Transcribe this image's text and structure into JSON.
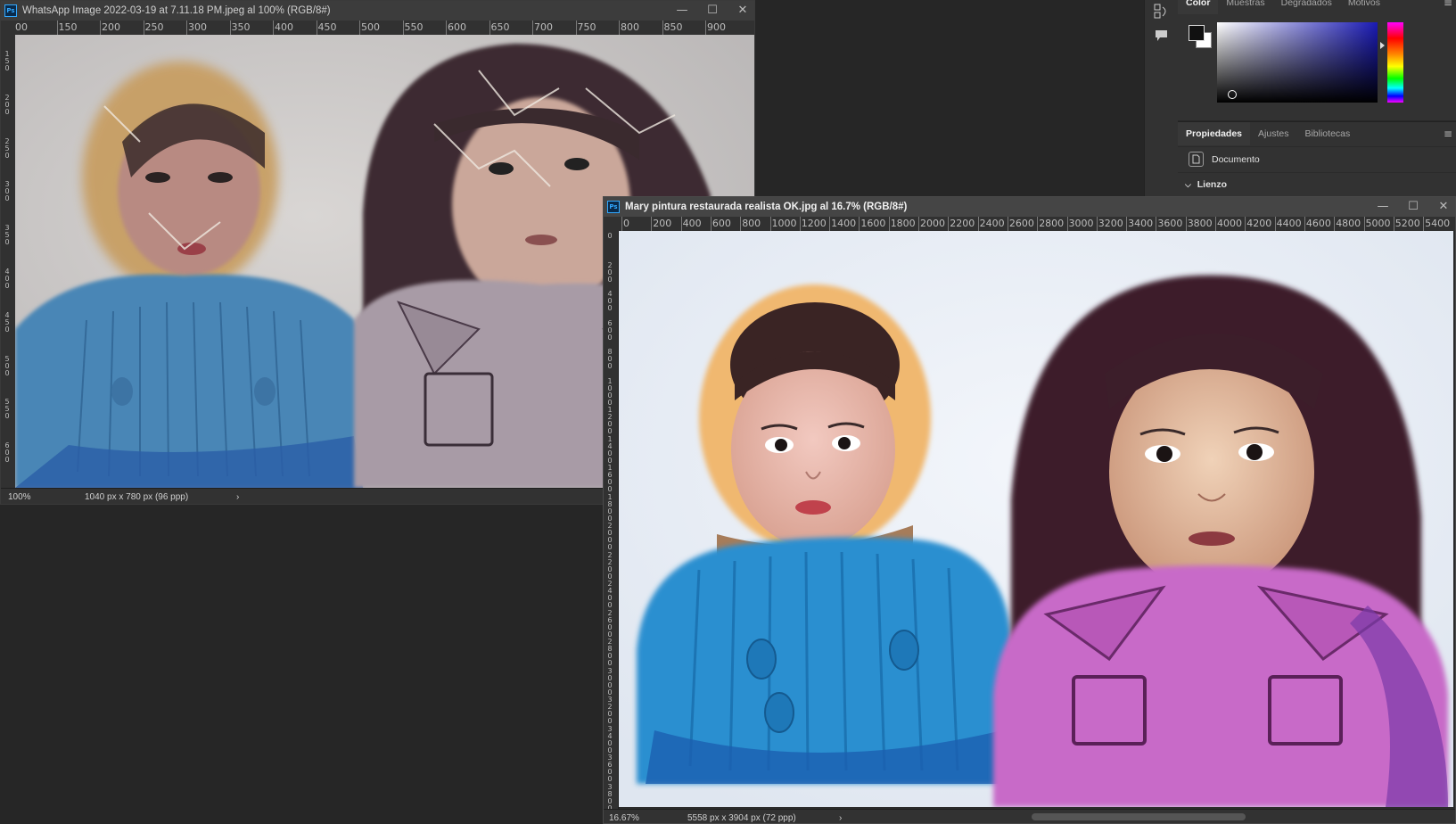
{
  "doc1": {
    "title": "WhatsApp Image 2022-03-19 at 7.11.18 PM.jpeg al 100% (RGB/8#)",
    "ruler_h": [
      "00",
      "150",
      "200",
      "250",
      "300",
      "350",
      "400",
      "450",
      "500",
      "550",
      "600",
      "650",
      "700",
      "750",
      "800",
      "850",
      "900"
    ],
    "ruler_v": [
      "1\n5\n0",
      "2\n0\n0",
      "2\n5\n0",
      "3\n0\n0",
      "3\n5\n0",
      "4\n0\n0",
      "4\n5\n0",
      "5\n0\n0",
      "5\n5\n0",
      "6\n0\n0"
    ],
    "zoom": "100%",
    "size_info": "1040 px x 780 px (96 ppp)",
    "status_arrow": "›"
  },
  "doc2": {
    "title": "Mary pintura restaurada realista OK.jpg al 16.7% (RGB/8#)",
    "ruler_h": [
      "0",
      "200",
      "400",
      "600",
      "800",
      "1000",
      "1200",
      "1400",
      "1600",
      "1800",
      "2000",
      "2200",
      "2400",
      "2600",
      "2800",
      "3000",
      "3200",
      "3400",
      "3600",
      "3800",
      "4000",
      "4200",
      "4400",
      "4600",
      "4800",
      "5000",
      "5200",
      "5400"
    ],
    "ruler_v": [
      "0",
      "2\n0\n0",
      "4\n0\n0",
      "6\n0\n0",
      "8\n0\n0",
      "1\n0\n0\n0",
      "1\n2\n0\n0",
      "1\n4\n0\n0",
      "1\n6\n0\n0",
      "1\n8\n0\n0",
      "2\n0\n0\n0",
      "2\n2\n0\n0",
      "2\n4\n0\n0",
      "2\n6\n0\n0",
      "2\n8\n0\n0",
      "3\n0\n0\n0",
      "3\n2\n0\n0",
      "3\n4\n0\n0",
      "3\n6\n0\n0",
      "3\n8\n0\n0"
    ],
    "zoom": "16.67%",
    "size_info": "5558 px x 3904 px (72 ppp)",
    "status_arrow": "›"
  },
  "color_panel": {
    "tabs": [
      "Color",
      "Muestras",
      "Degradados",
      "Motivos"
    ],
    "active_tab": "Color",
    "foreground": "#111111",
    "background": "#ffffff",
    "hue_color": "#1a1aa8"
  },
  "props_panel": {
    "tabs": [
      "Propiedades",
      "Ajustes",
      "Bibliotecas"
    ],
    "active_tab": "Propiedades",
    "doc_label": "Documento",
    "section": "Lienzo"
  },
  "icons": {
    "history": "history-icon",
    "comments": "comment-icon"
  }
}
